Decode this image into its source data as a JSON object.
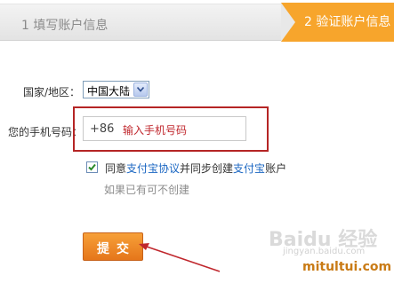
{
  "steps": {
    "step1_label": "1 填写账户信息",
    "step2_label": "2 验证账户信息"
  },
  "form": {
    "country_label": "国家/地区：",
    "country_value": "中国大陆",
    "phone_label": "您的手机号码：",
    "phone_prefix": "+86",
    "phone_placeholder": "输入手机号码",
    "agree_prefix": "同意",
    "agree_link1": "支付宝协议",
    "agree_middle": "并同步创建",
    "agree_link2": "支付宝",
    "agree_suffix": "账户",
    "agree_checked": true,
    "agree_hint": "如果已有可不创建",
    "submit_label": "提交"
  },
  "watermark": {
    "baidu": "Baidu 经验",
    "jingyan": "jingyan.baidu.com",
    "site": "mitultui.com"
  },
  "colors": {
    "accent": "#f7a52c",
    "highlight": "#b52525",
    "link": "#1a66c2"
  }
}
